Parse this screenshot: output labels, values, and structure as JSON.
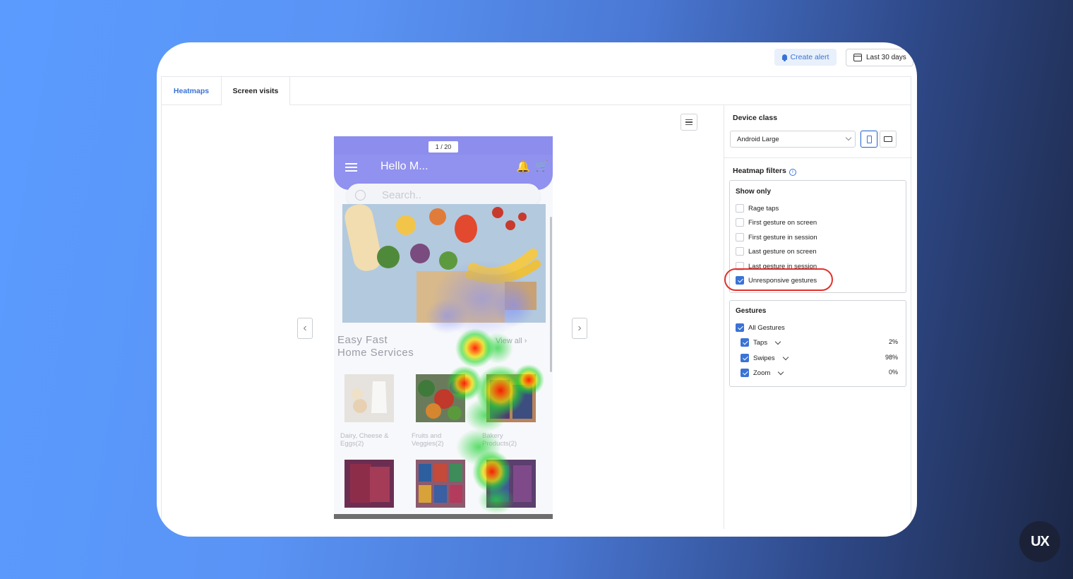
{
  "toolbar": {
    "create_alert_label": "Create alert",
    "date_range_label": "Last 30 days"
  },
  "tabs": [
    {
      "label": "Heatmaps",
      "active": true
    },
    {
      "label": "Screen visits",
      "active": false
    }
  ],
  "viewer": {
    "screen_counter": "1 / 20",
    "app": {
      "greeting": "Hello M...",
      "search_placeholder": "Search..",
      "section_title_line1": "Easy Fast",
      "section_title_line2": "Home Services",
      "view_all": "View all",
      "products": [
        {
          "label": "Dairy, Cheese & Eggs(2)"
        },
        {
          "label": "Fruits and Veggies(2)"
        },
        {
          "label": "Bakery Products(2)"
        }
      ]
    }
  },
  "device_class": {
    "label": "Device class",
    "selected": "Android Large"
  },
  "heatmap_filters": {
    "label": "Heatmap filters",
    "show_only": {
      "title": "Show only",
      "options": [
        {
          "label": "Rage taps",
          "checked": false
        },
        {
          "label": "First gesture on screen",
          "checked": false
        },
        {
          "label": "First gesture in session",
          "checked": false
        },
        {
          "label": "Last gesture on screen",
          "checked": false
        },
        {
          "label": "Last gesture in session",
          "checked": false
        },
        {
          "label": "Unresponsive gestures",
          "checked": true
        }
      ]
    },
    "gestures": {
      "title": "Gestures",
      "all_label": "All Gestures",
      "items": [
        {
          "label": "Taps",
          "percent": "2%",
          "checked": true
        },
        {
          "label": "Swipes",
          "percent": "98%",
          "checked": true
        },
        {
          "label": "Zoom",
          "percent": "0%",
          "checked": true
        }
      ]
    }
  },
  "brand": {
    "logo_text": "UX"
  },
  "colors": {
    "accent": "#3a73d6",
    "highlight": "#e2302b",
    "app_header": "#9191f0"
  }
}
